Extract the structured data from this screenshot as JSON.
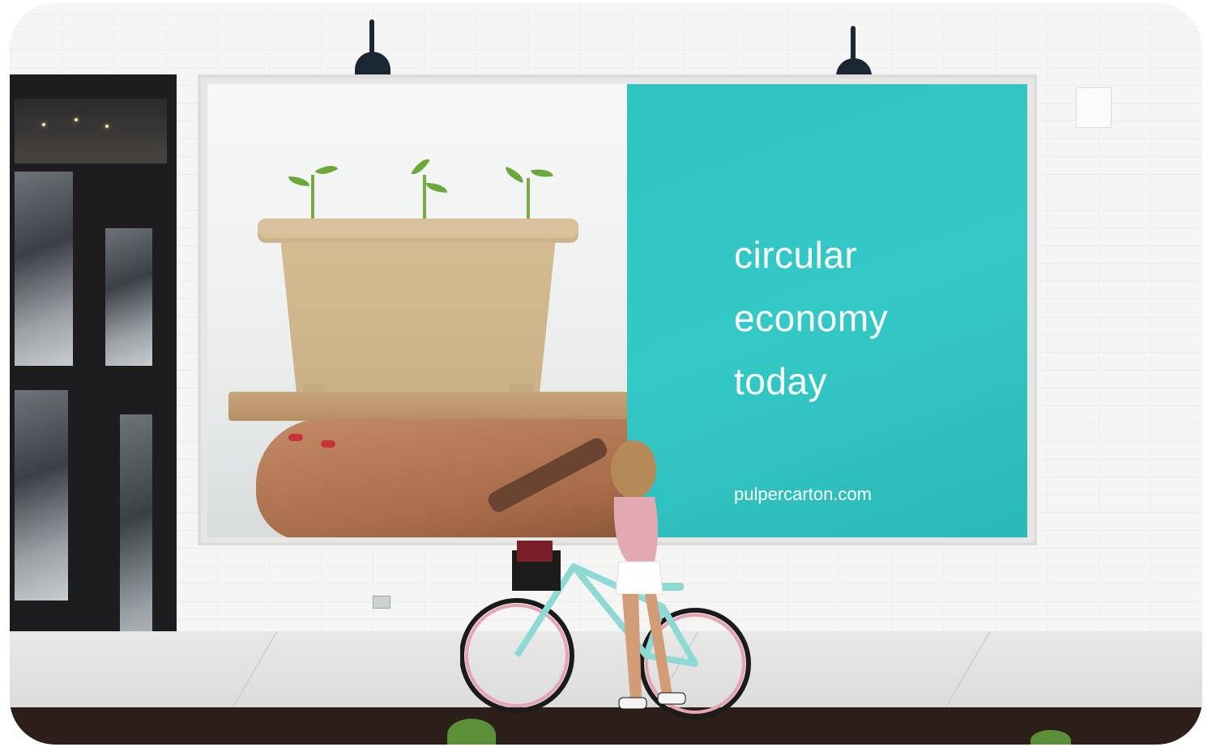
{
  "billboard": {
    "headline": [
      "circular",
      "economy",
      "today"
    ],
    "website": "pulpercarton.com",
    "accent_color": "#33c6c3",
    "text_color": "#ffffff"
  },
  "scene": {
    "subjects": [
      "pot-with-seedlings",
      "hand",
      "woman",
      "bicycle",
      "wall-lamp",
      "doorway"
    ]
  }
}
